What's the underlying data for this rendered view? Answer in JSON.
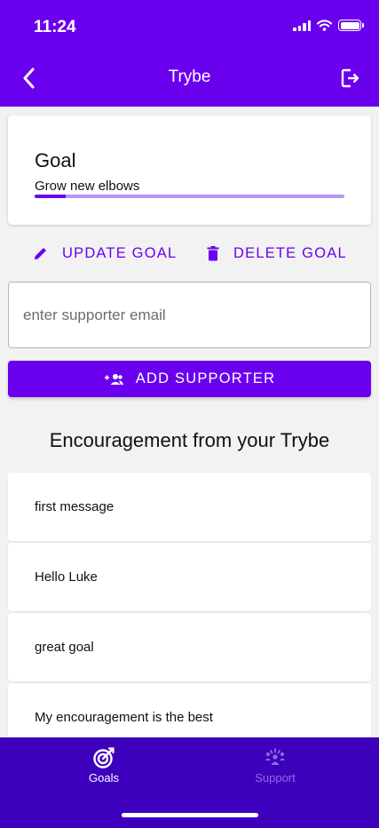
{
  "status_bar": {
    "time": "11:24"
  },
  "header": {
    "title": "Trybe"
  },
  "goal_card": {
    "heading": "Goal",
    "goal_text": "Grow new elbows",
    "progress_percent": 10
  },
  "actions": {
    "update_label": "UPDATE GOAL",
    "delete_label": "DELETE GOAL"
  },
  "supporter": {
    "email_placeholder": "enter supporter email",
    "add_label": "ADD SUPPORTER"
  },
  "encouragement": {
    "title": "Encouragement from your Trybe",
    "messages": [
      "first message",
      "Hello Luke",
      "great goal",
      "My encouragement is the best"
    ]
  },
  "tab_bar": {
    "goals_label": "Goals",
    "support_label": "Support"
  },
  "colors": {
    "primary": "#6a00ee",
    "tab_bar": "#3d00bd",
    "progress_track": "#b794f6",
    "inactive_tab": "#8c6fe0"
  }
}
